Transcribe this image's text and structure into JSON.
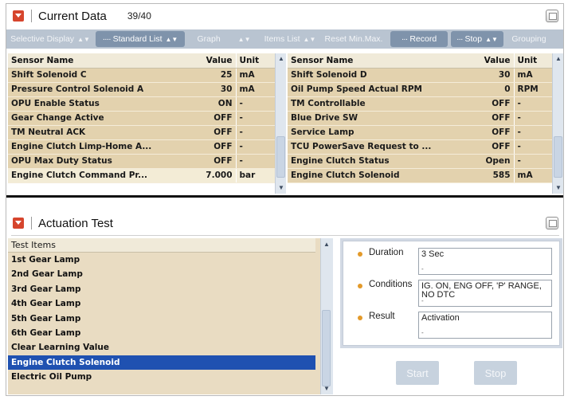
{
  "current_data": {
    "title": "Current Data",
    "count": "39/40"
  },
  "toolbar": {
    "selective_display": "Selective Display",
    "standard_list": "Standard List",
    "graph": "Graph",
    "items_list": "Items List",
    "reset_min_max": "Reset Min.Max.",
    "record": "Record",
    "stop": "Stop",
    "grouping": "Grouping"
  },
  "left_table": {
    "headers": {
      "name": "Sensor Name",
      "value": "Value",
      "unit": "Unit"
    },
    "rows": [
      {
        "name": "Shift Solenoid C",
        "value": "25",
        "unit": "mA"
      },
      {
        "name": "Pressure Control Solenoid A",
        "value": "30",
        "unit": "mA"
      },
      {
        "name": "OPU Enable Status",
        "value": "ON",
        "unit": "-"
      },
      {
        "name": "Gear Change Active",
        "value": "OFF",
        "unit": "-"
      },
      {
        "name": "TM Neutral ACK",
        "value": "OFF",
        "unit": "-"
      },
      {
        "name": "Engine Clutch Limp-Home A...",
        "value": "OFF",
        "unit": "-"
      },
      {
        "name": "OPU Max Duty Status",
        "value": "OFF",
        "unit": "-"
      },
      {
        "name": "Engine Clutch Command Pr...",
        "value": "7.000",
        "unit": "bar"
      }
    ]
  },
  "right_table": {
    "headers": {
      "name": "Sensor Name",
      "value": "Value",
      "unit": "Unit"
    },
    "rows": [
      {
        "name": "Shift Solenoid D",
        "value": "30",
        "unit": "mA"
      },
      {
        "name": "Oil Pump Speed Actual RPM",
        "value": "0",
        "unit": "RPM"
      },
      {
        "name": "TM Controllable",
        "value": "OFF",
        "unit": "-"
      },
      {
        "name": "Blue Drive SW",
        "value": "OFF",
        "unit": "-"
      },
      {
        "name": "Service Lamp",
        "value": "OFF",
        "unit": "-"
      },
      {
        "name": "TCU PowerSave Request to ...",
        "value": "OFF",
        "unit": "-"
      },
      {
        "name": "Engine Clutch Status",
        "value": "Open",
        "unit": "-"
      },
      {
        "name": "Engine Clutch Solenoid",
        "value": "585",
        "unit": "mA"
      }
    ]
  },
  "actuation": {
    "title": "Actuation Test",
    "list_header": "Test Items",
    "items": [
      "1st Gear Lamp",
      "2nd Gear Lamp",
      "3rd Gear Lamp",
      "4th Gear Lamp",
      "5th Gear Lamp",
      "6th Gear Lamp",
      "Clear Learning Value",
      "Engine Clutch Solenoid",
      "Electric Oil Pump"
    ],
    "selected_item": "Engine Clutch Solenoid",
    "duration_label": "Duration",
    "duration_value": "3 Sec",
    "conditions_label": "Conditions",
    "conditions_value": "IG. ON, ENG OFF, 'P' RANGE, NO DTC",
    "result_label": "Result",
    "result_value": "Activation",
    "start_label": "Start",
    "stop_label": "Stop"
  },
  "colors": {
    "accent_red": "#d6452d",
    "row_tan": "#e3d2ae",
    "selected_blue": "#1f51b1",
    "toolbar": "#b9c4d1",
    "bullet_orange": "#e39a2a"
  }
}
